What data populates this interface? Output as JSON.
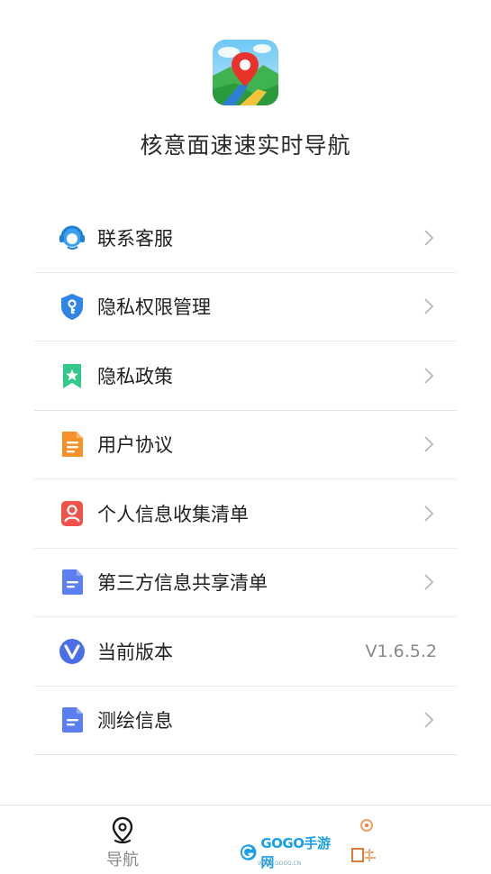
{
  "app": {
    "name": "核意面速速实时导航"
  },
  "menu": [
    {
      "label": "联系客服",
      "icon": "customer-service-icon",
      "has_arrow": true
    },
    {
      "label": "隐私权限管理",
      "icon": "shield-key-icon",
      "has_arrow": true
    },
    {
      "label": "隐私政策",
      "icon": "bookmark-star-icon",
      "has_arrow": true
    },
    {
      "label": "用户协议",
      "icon": "document-icon",
      "has_arrow": true
    },
    {
      "label": "个人信息收集清单",
      "icon": "person-card-icon",
      "has_arrow": true
    },
    {
      "label": "第三方信息共享清单",
      "icon": "document-list-icon",
      "has_arrow": true
    },
    {
      "label": "当前版本",
      "icon": "version-v-icon",
      "value": "V1.6.5.2"
    },
    {
      "label": "测绘信息",
      "icon": "document-list-icon",
      "has_arrow": true
    }
  ],
  "tabbar": {
    "nav_label": "导航",
    "watermark": "GOGO手游网",
    "watermark_url": "WWW.GOGO.CN"
  },
  "colors": {
    "text": "#1f1f1f",
    "muted": "#888888",
    "divider": "#ececec"
  }
}
